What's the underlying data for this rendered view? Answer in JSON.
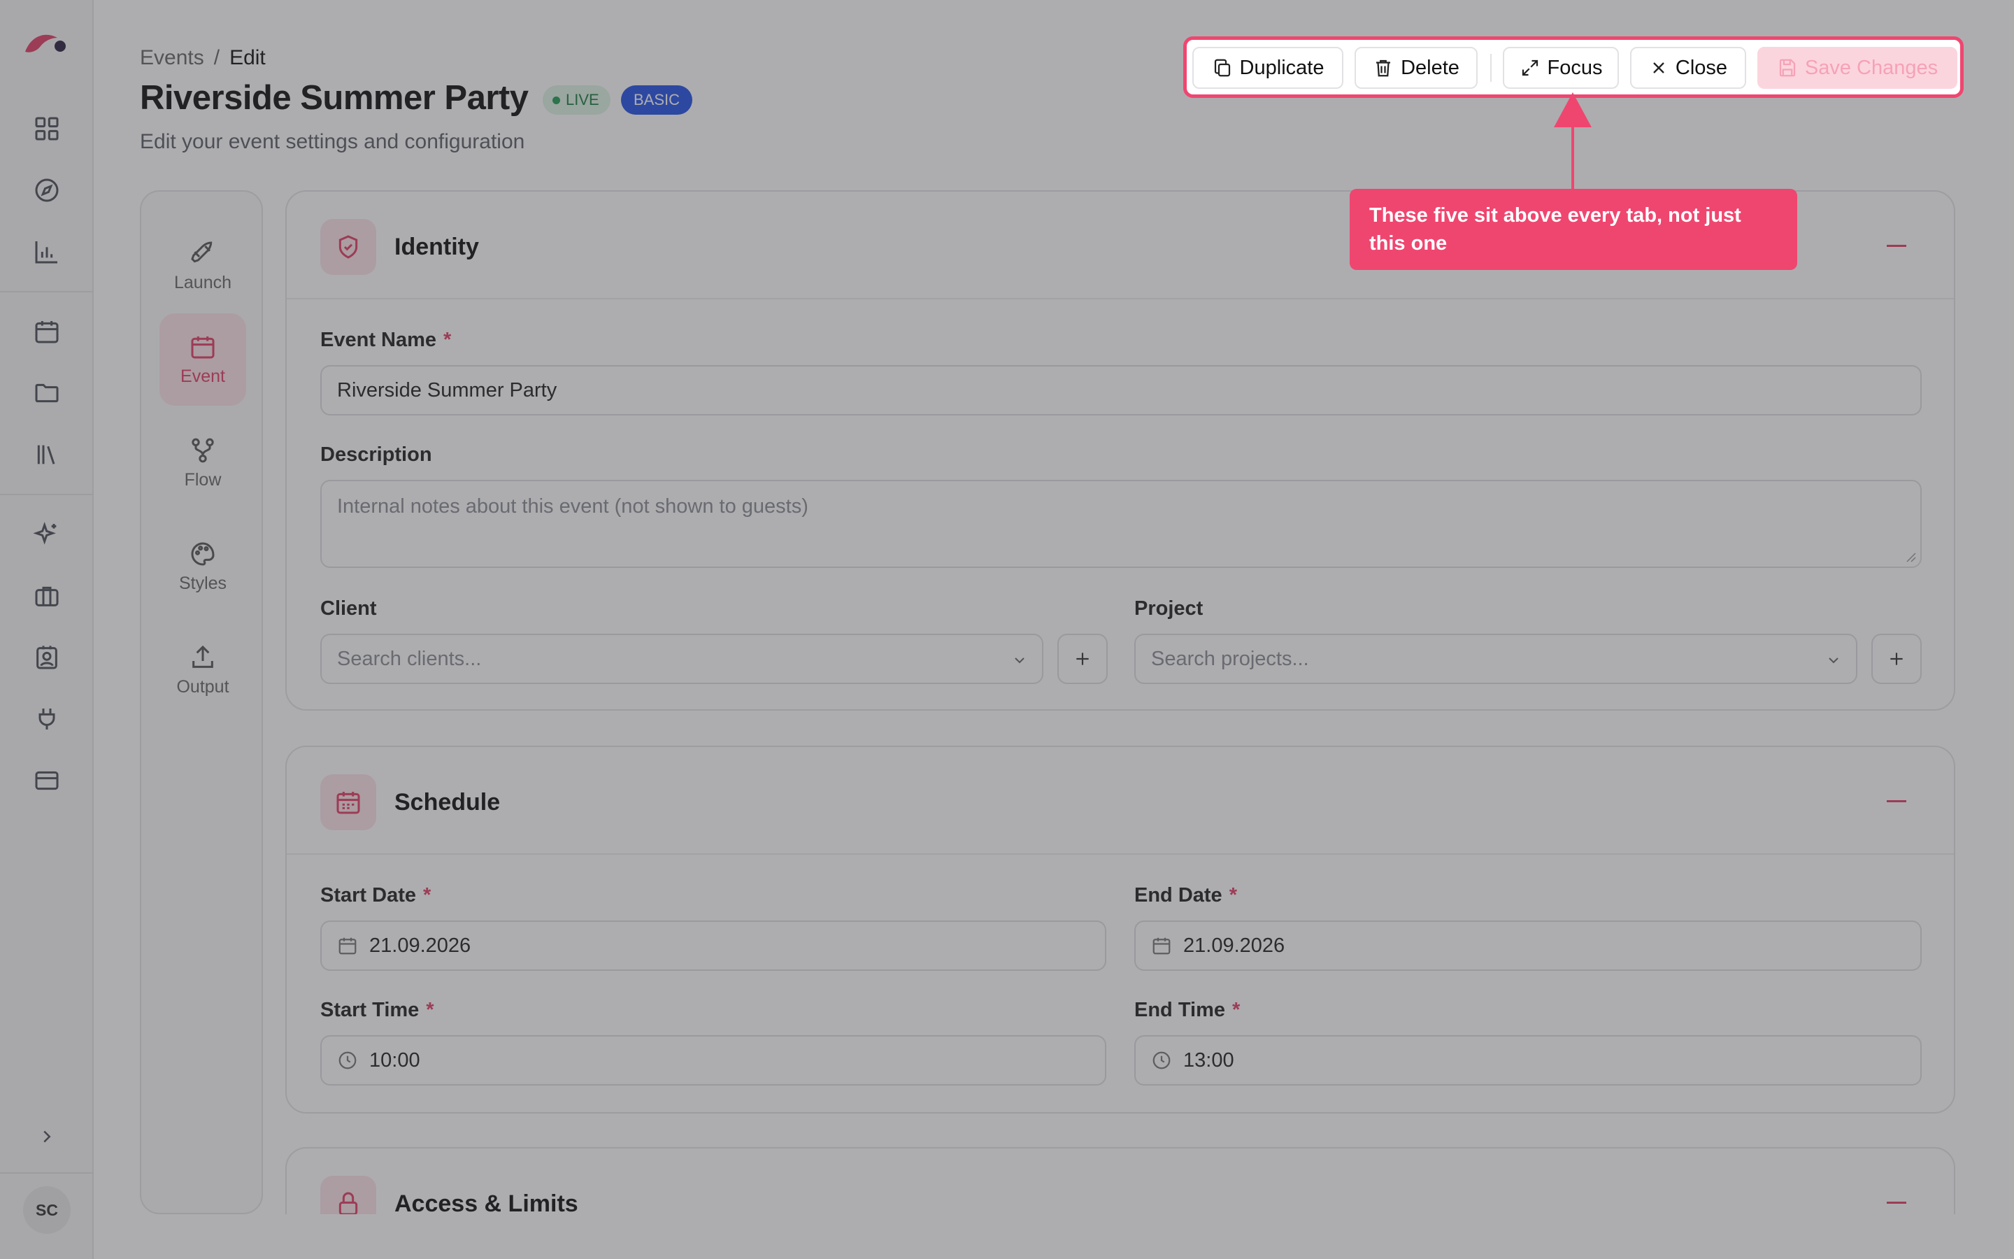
{
  "breadcrumb": {
    "root": "Events",
    "separator": "/",
    "current": "Edit"
  },
  "page": {
    "title": "Riverside Summer Party",
    "status_badge": "LIVE",
    "plan_badge": "BASIC",
    "subtitle": "Edit your event settings and configuration"
  },
  "toolbar": {
    "duplicate": "Duplicate",
    "delete": "Delete",
    "focus": "Focus",
    "close": "Close",
    "save": "Save Changes"
  },
  "callout": {
    "text": "These five sit above every tab, not just this one"
  },
  "tabs": [
    {
      "label": "Launch",
      "icon": "rocket-icon"
    },
    {
      "label": "Event",
      "icon": "calendar-icon",
      "active": true
    },
    {
      "label": "Flow",
      "icon": "flow-icon"
    },
    {
      "label": "Styles",
      "icon": "palette-icon"
    },
    {
      "label": "Output",
      "icon": "upload-icon"
    }
  ],
  "identity": {
    "title": "Identity",
    "event_name_label": "Event Name",
    "event_name_value": "Riverside Summer Party",
    "description_label": "Description",
    "description_placeholder": "Internal notes about this event (not shown to guests)",
    "client_label": "Client",
    "client_placeholder": "Search clients...",
    "project_label": "Project",
    "project_placeholder": "Search projects..."
  },
  "schedule": {
    "title": "Schedule",
    "start_date_label": "Start Date",
    "start_date_value": "21.09.2026",
    "end_date_label": "End Date",
    "end_date_value": "21.09.2026",
    "start_time_label": "Start Time",
    "start_time_value": "10:00",
    "end_time_label": "End Time",
    "end_time_value": "13:00"
  },
  "access": {
    "title": "Access & Limits"
  },
  "user": {
    "initials": "SC"
  },
  "required_mark": "*",
  "colors": {
    "accent": "#ef4670",
    "live": "#1f9d55",
    "basic": "#2452e6"
  }
}
